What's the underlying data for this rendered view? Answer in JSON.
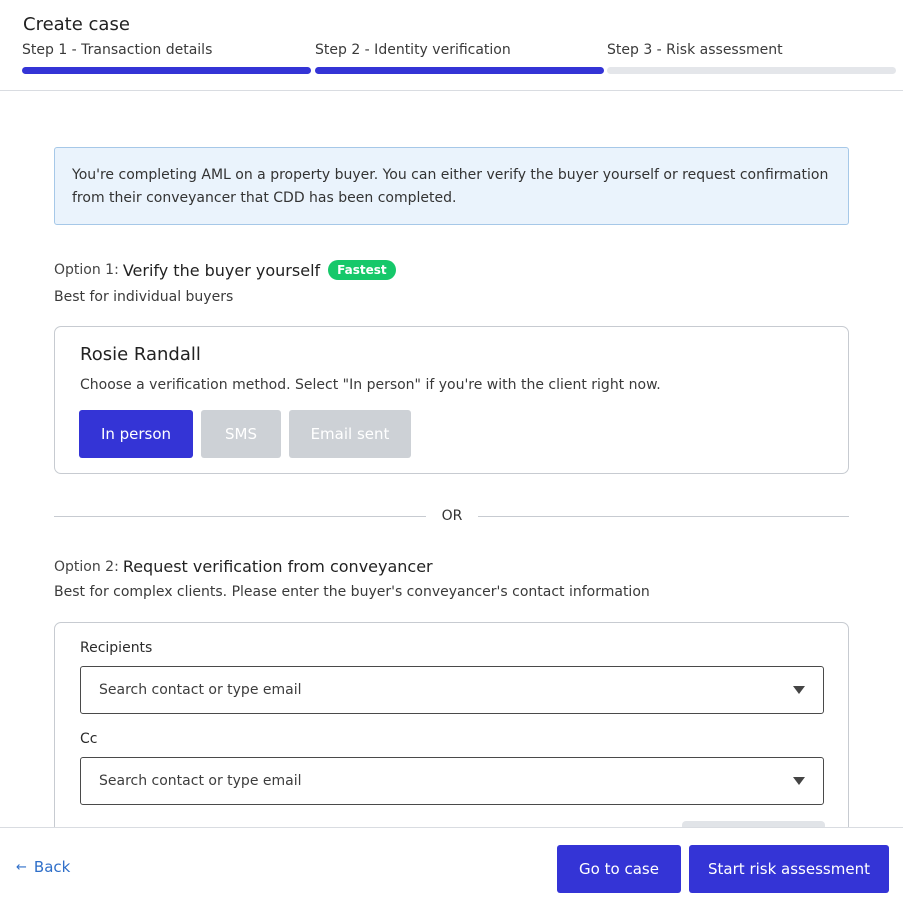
{
  "header": {
    "title": "Create case",
    "steps": [
      {
        "label": "Step 1 - Transaction details",
        "state": "done"
      },
      {
        "label": "Step 2 - Identity verification",
        "state": "done"
      },
      {
        "label": "Step 3 - Risk assessment",
        "state": "pending"
      }
    ]
  },
  "info": {
    "text": "You're completing AML on a property buyer. You can either verify the buyer yourself or request confirmation from their conveyancer that CDD has been completed."
  },
  "option1": {
    "prefix": "Option 1:",
    "title": "Verify the buyer yourself",
    "badge": "Fastest",
    "subtitle": "Best for individual buyers",
    "client_name": "Rosie Randall",
    "hint": "Choose a verification method. Select \"In person\" if you're with the client right now.",
    "methods": {
      "in_person": "In person",
      "sms": "SMS",
      "email": "Email sent"
    }
  },
  "divider": {
    "text": "OR"
  },
  "option2": {
    "prefix": "Option 2:",
    "title": "Request verification from conveyancer",
    "subtitle": "Best for complex clients. Please enter the buyer's conveyancer's contact information",
    "recipients_label": "Recipients",
    "recipients_placeholder": "Search contact or type email",
    "cc_label": "Cc",
    "cc_placeholder": "Search contact or type email"
  },
  "footer": {
    "back": "Back",
    "go_to_case": "Go to case",
    "start_risk": "Start risk assessment"
  },
  "colors": {
    "primary": "#3434d6",
    "badge": "#16c86a",
    "info_bg": "#eaf3fc",
    "link": "#2f6fc9",
    "disabled": "#cdd1d6"
  }
}
